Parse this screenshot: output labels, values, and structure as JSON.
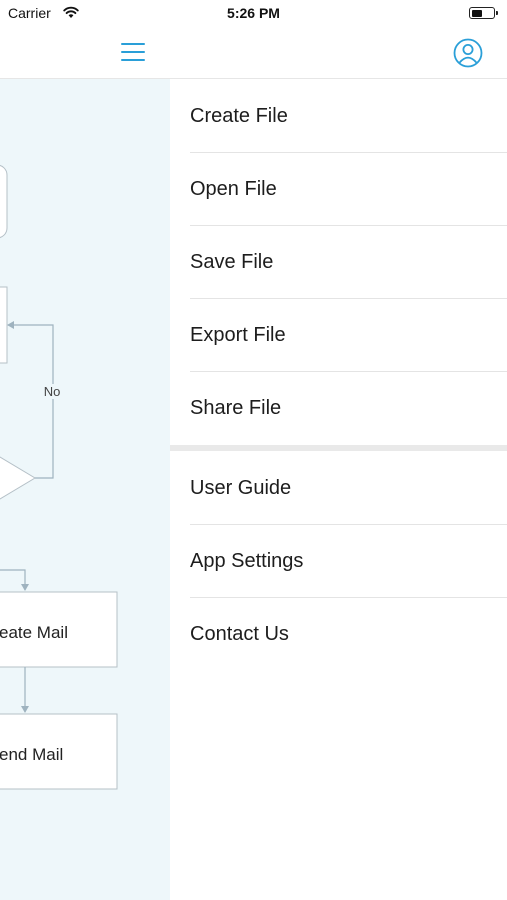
{
  "status": {
    "carrier": "Carrier",
    "time": "5:26 PM"
  },
  "diagram": {
    "no_label": "No",
    "create_mail_label": "eate Mail",
    "send_mail_label": "end Mail"
  },
  "drawer": {
    "file_items": [
      {
        "label": "Create File"
      },
      {
        "label": "Open File"
      },
      {
        "label": "Save File"
      },
      {
        "label": "Export File"
      },
      {
        "label": "Share File"
      }
    ],
    "app_items": [
      {
        "label": "User Guide"
      },
      {
        "label": "App Settings"
      },
      {
        "label": "Contact Us"
      }
    ]
  },
  "colors": {
    "accent": "#2a9fd8",
    "canvas_bg": "#eef7fa",
    "connector": "#9fb3bf"
  },
  "icons": {
    "menu": "hamburger-icon",
    "profile": "user-circle-icon",
    "wifi": "wifi-icon",
    "battery": "battery-icon"
  }
}
